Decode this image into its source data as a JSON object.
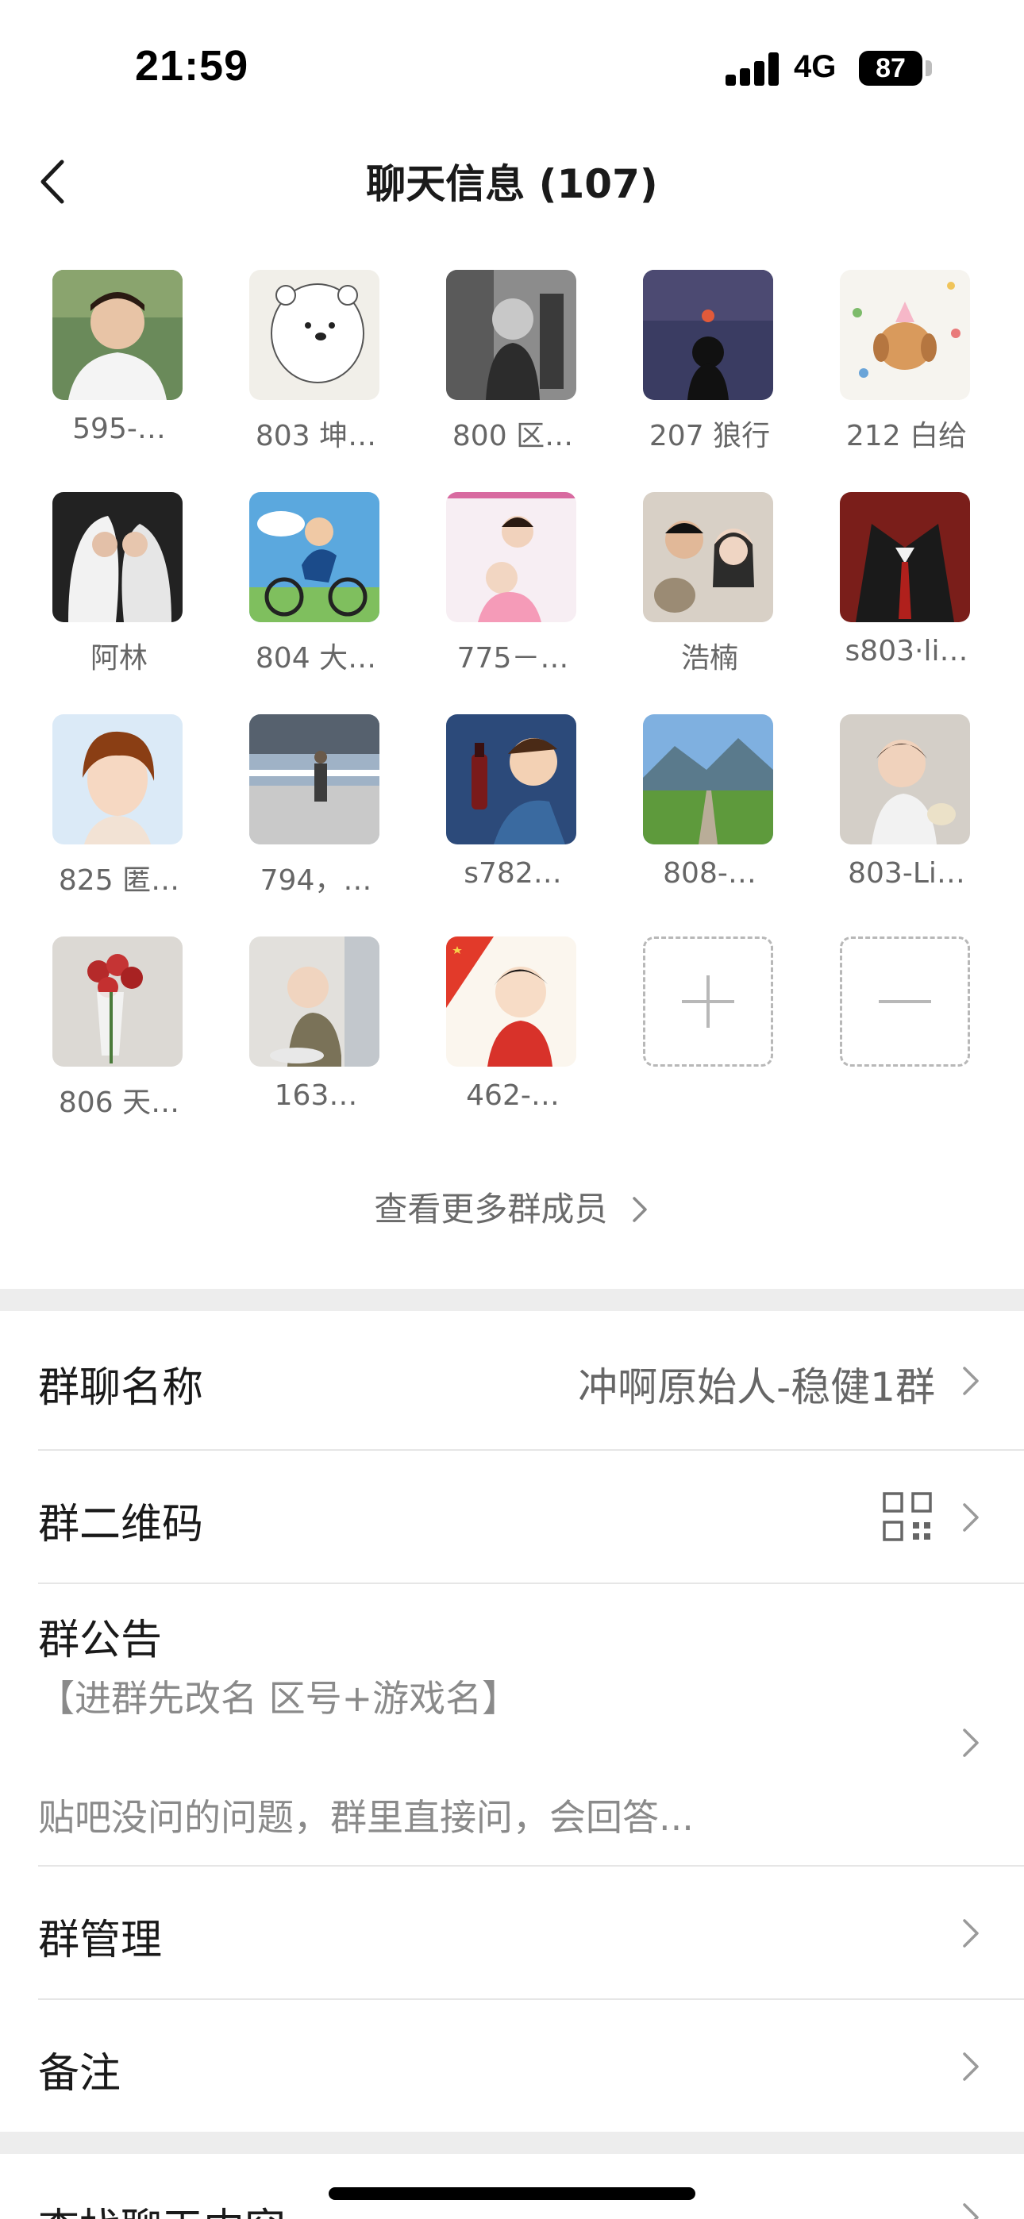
{
  "status": {
    "time": "21:59",
    "network": "4G",
    "battery": "87"
  },
  "nav": {
    "title": "聊天信息 (107)"
  },
  "members": [
    {
      "name": "595-…",
      "icon": "avatar-photo-man"
    },
    {
      "name": "803 坤…",
      "icon": "avatar-white-bear"
    },
    {
      "name": "800 区…",
      "icon": "avatar-bw-boy"
    },
    {
      "name": "207 狼行",
      "icon": "avatar-sunset-silhouette"
    },
    {
      "name": "212 白给",
      "icon": "avatar-cartoon-dog"
    },
    {
      "name": "阿林",
      "icon": "avatar-couple-kiss"
    },
    {
      "name": "804 大…",
      "icon": "avatar-cartoon-cyclist"
    },
    {
      "name": "775－…",
      "icon": "avatar-babies"
    },
    {
      "name": "浩楠",
      "icon": "avatar-couple-cat"
    },
    {
      "name": "s803·li…",
      "icon": "avatar-suit-red-tie"
    },
    {
      "name": "825 匿…",
      "icon": "avatar-anime-boy"
    },
    {
      "name": "794，…",
      "icon": "avatar-man-on-deck"
    },
    {
      "name": "s782…",
      "icon": "avatar-cartoon-boy-bottle"
    },
    {
      "name": "808-…",
      "icon": "avatar-mountain-road"
    },
    {
      "name": "803-Li…",
      "icon": "avatar-toddler-girl"
    },
    {
      "name": "806 天…",
      "icon": "avatar-red-roses"
    },
    {
      "name": "163…",
      "icon": "avatar-baby-sitting"
    },
    {
      "name": "462-…",
      "icon": "avatar-cartoon-boy-flag"
    }
  ],
  "actions": {
    "add_icon": "plus-icon",
    "remove_icon": "minus-icon"
  },
  "more_members": "查看更多群成员",
  "settings": {
    "group_name_label": "群聊名称",
    "group_name_value": "冲啊原始人-稳健1群",
    "qr_label": "群二维码",
    "notice_label": "群公告",
    "notice_line1": "【进群先改名 区号+游戏名】",
    "notice_line2": "贴吧没问的问题，群里直接问，会回答...",
    "manage_label": "群管理",
    "remark_label": "备注",
    "search_label": "查找聊天内容"
  }
}
